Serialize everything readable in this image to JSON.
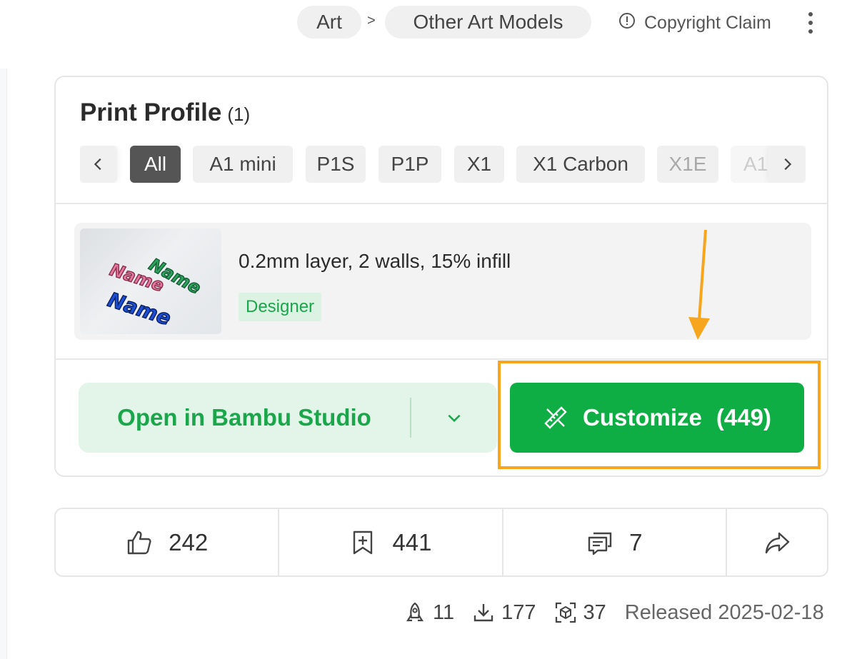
{
  "breadcrumb": {
    "items": [
      "Art",
      "Other Art Models"
    ],
    "separator": ">"
  },
  "copyright": {
    "label": "Copyright Claim"
  },
  "print_profile": {
    "title": "Print Profile",
    "count": "(1)",
    "filters": [
      "All",
      "A1 mini",
      "P1S",
      "P1P",
      "X1",
      "X1 Carbon",
      "X1E",
      "A1"
    ],
    "active_filter": "All",
    "profile": {
      "name": "0.2mm layer, 2 walls, 15% infill",
      "tag": "Designer",
      "thumbnail_texts": [
        "Name",
        "Name",
        "Name"
      ]
    },
    "open_button": "Open in Bambu Studio",
    "customize_button": "Customize",
    "customize_count": "(449)"
  },
  "actions": {
    "likes": "242",
    "collects": "441",
    "comments": "7"
  },
  "stats": {
    "boosts": "11",
    "downloads": "177",
    "prints": "37",
    "released": "Released 2025-02-18"
  },
  "colors": {
    "accent_green": "#0fae45",
    "light_green": "#e3f5e8",
    "annotation_orange": "#f7a51c",
    "chip_active": "#555555"
  }
}
